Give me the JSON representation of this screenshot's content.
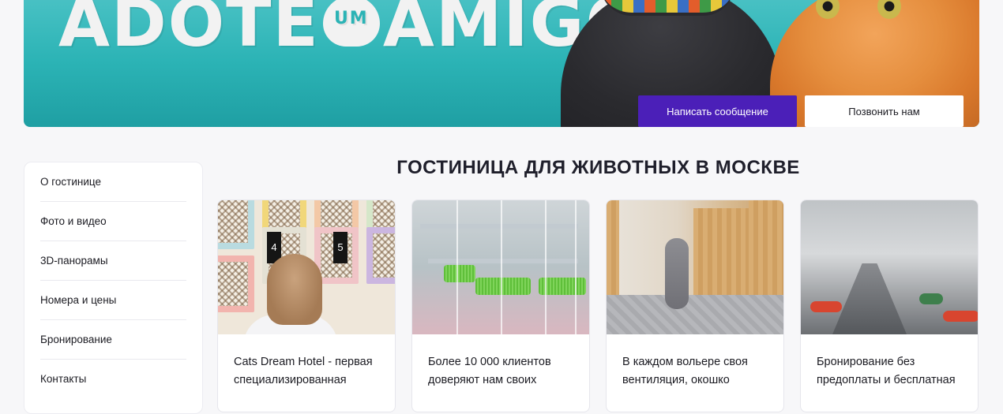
{
  "banner": {
    "title_left": "ADOTE",
    "title_heart": "UM",
    "title_right": "AMIGO",
    "primary_button": "Написать сообщение",
    "secondary_button": "Позвонить нам"
  },
  "sidebar": {
    "items": [
      {
        "label": "О гостинице"
      },
      {
        "label": "Фото и видео"
      },
      {
        "label": "3D-панорамы"
      },
      {
        "label": "Номера и цены"
      },
      {
        "label": "Бронирование"
      },
      {
        "label": "Контакты"
      }
    ]
  },
  "main": {
    "title": "ГОСТИНИЦА ДЛЯ ЖИВОТНЫХ В МОСКВЕ",
    "cards": [
      {
        "text": "Cats Dream Hotel - первая специализированная"
      },
      {
        "text": "Более 10 000 клиентов доверяют нам своих"
      },
      {
        "text": "В каждом вольере своя вентиляция, окошко"
      },
      {
        "text": "Бронирование без предоплаты и бесплатная"
      }
    ],
    "card1_locker_numbers": [
      "4",
      "5"
    ]
  },
  "colors": {
    "accent": "#4b1fb8",
    "banner_teal": "#2bb3b5"
  }
}
